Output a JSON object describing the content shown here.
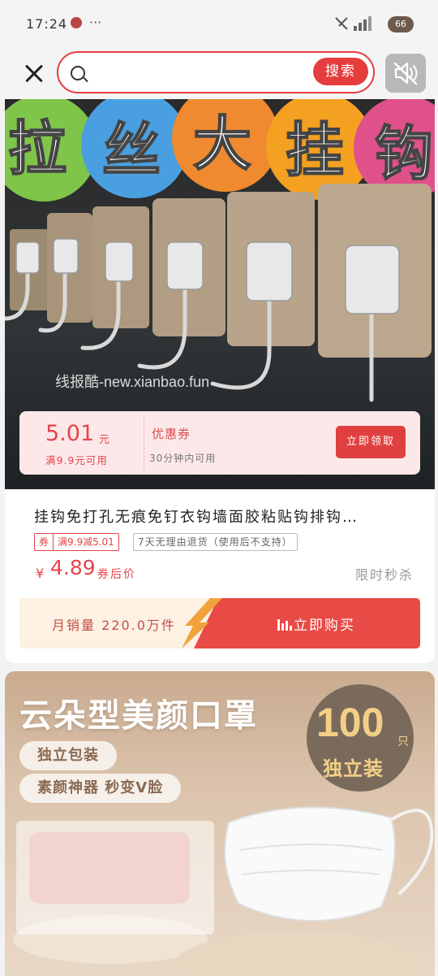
{
  "status_bar": {
    "time": "17:24",
    "dots": "···",
    "signal": "⁴ᴳ",
    "battery": "66"
  },
  "search": {
    "placeholder": "",
    "button_label": "搜索"
  },
  "product1": {
    "banner_text": [
      "拉",
      "丝",
      "大",
      "挂",
      "钩"
    ],
    "watermark": "线报酷-new.xianbao.fun",
    "coupon": {
      "amount": "5.01",
      "unit": "元",
      "condition": "满9.9元可用",
      "title": "优惠券",
      "valid": "30分钟内可用",
      "button": "立即领取"
    },
    "title": "挂钩免打孔无痕免钉衣钩墙面胶粘贴钩排钩…",
    "tags": {
      "coupon_q": "券",
      "coupon_detail": "满9.9减5.01",
      "return": "7天无理由退货（使用后不支持）"
    },
    "price_symbol": "¥",
    "price": "4.89",
    "price_note": "券后价",
    "flash_sale": "限时秒杀",
    "sales": "月销量 220.0万件",
    "buy_button": "立即购买"
  },
  "product2": {
    "title": "云朵型美颜口罩",
    "chip1": "独立包装",
    "chip2": "素颜神器 秒变V脸",
    "badge_number": "100",
    "badge_unit": "只",
    "badge_text": "独立装"
  },
  "colors": {
    "accent": "#e53d3d",
    "bubble_colors": [
      "#7fc54a",
      "#4a9fe0",
      "#f08a30",
      "#f4a020",
      "#e0508a"
    ]
  }
}
